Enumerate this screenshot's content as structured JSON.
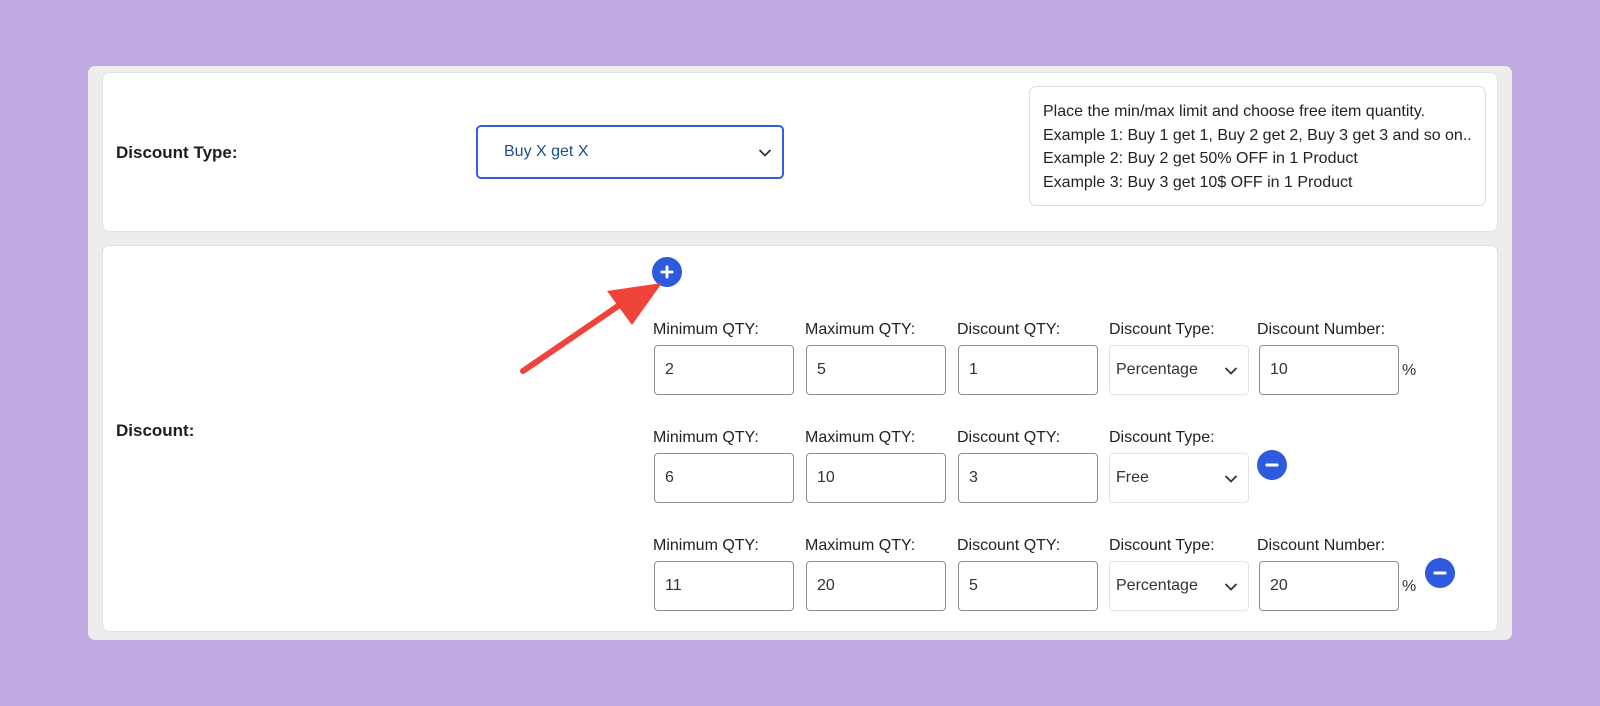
{
  "discount_type_row": {
    "label": "Discount Type:",
    "selected": "Buy X get X",
    "help_lines": [
      "Place the min/max limit and choose free item quantity.",
      "Example 1: Buy 1 get 1, Buy 2 get 2, Buy 3 get 3 and so on..",
      "Example 2: Buy 2 get 50% OFF in 1 Product",
      "Example 3: Buy 3 get 10$ OFF in 1 Product"
    ]
  },
  "discount_row": {
    "label": "Discount:",
    "field_labels": {
      "min": "Minimum QTY:",
      "max": "Maximum QTY:",
      "qty": "Discount QTY:",
      "type": "Discount Type:",
      "number": "Discount Number:"
    },
    "rules": [
      {
        "min": "2",
        "max": "5",
        "qty": "1",
        "type": "Percentage",
        "number": "10",
        "suffix": "%"
      },
      {
        "min": "6",
        "max": "10",
        "qty": "3",
        "type": "Free"
      },
      {
        "min": "11",
        "max": "20",
        "qty": "5",
        "type": "Percentage",
        "number": "20",
        "suffix": "%"
      }
    ]
  },
  "icons": {
    "add": "plus-circle-icon",
    "remove": "minus-circle-icon",
    "annotation": "red-arrow-icon"
  },
  "colors": {
    "background": "#c1a9e2",
    "accent": "#2e5ae0",
    "arrow": "#f0433a"
  }
}
